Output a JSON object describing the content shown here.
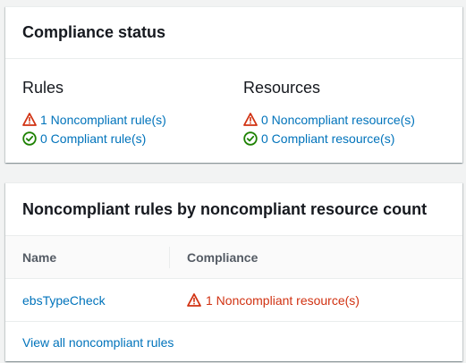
{
  "compliance_status": {
    "title": "Compliance status",
    "rules": {
      "title": "Rules",
      "noncompliant": "1 Noncompliant rule(s)",
      "compliant": "0 Compliant rule(s)"
    },
    "resources": {
      "title": "Resources",
      "noncompliant": "0 Noncompliant resource(s)",
      "compliant": "0 Compliant resource(s)"
    }
  },
  "noncompliant_rules": {
    "title": "Noncompliant rules by noncompliant resource count",
    "columns": [
      "Name",
      "Compliance"
    ],
    "rows": [
      {
        "name": "ebsTypeCheck",
        "compliance": "1 Noncompliant resource(s)"
      }
    ],
    "footer_link": "View all noncompliant rules"
  },
  "colors": {
    "link": "#0073bb",
    "error": "#d13212",
    "success": "#1d8102"
  },
  "icons": {
    "warning": "warning-icon",
    "success": "check-circle-icon"
  }
}
